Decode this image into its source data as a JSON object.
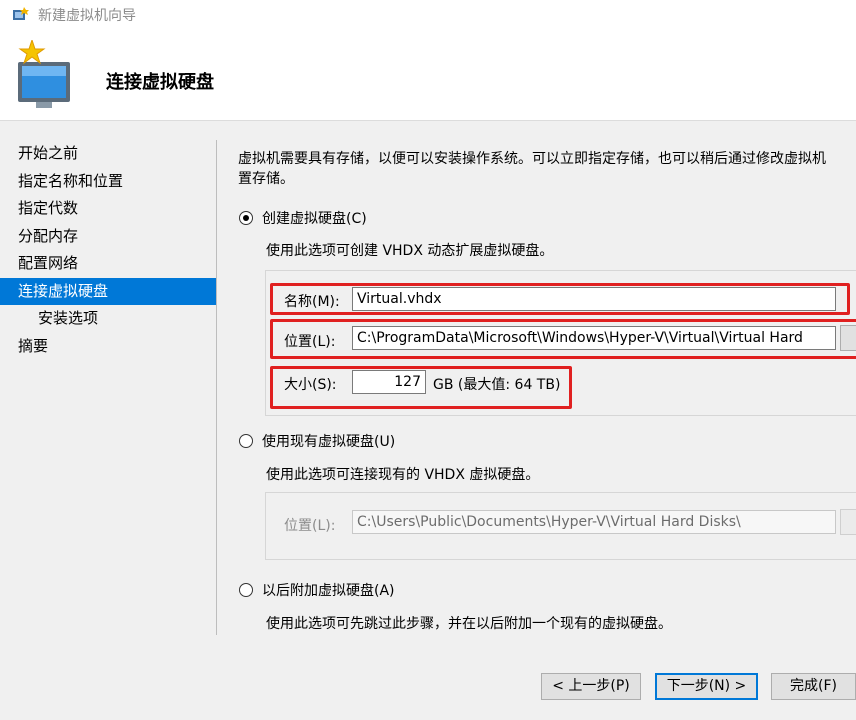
{
  "window": {
    "title": "新建虚拟机向导",
    "icon": "hyperv-icon"
  },
  "header": {
    "title": "连接虚拟硬盘",
    "icon": "wizard-monitor-star-icon"
  },
  "nav": {
    "items": [
      {
        "label": "开始之前"
      },
      {
        "label": "指定名称和位置"
      },
      {
        "label": "指定代数"
      },
      {
        "label": "分配内存"
      },
      {
        "label": "配置网络"
      },
      {
        "label": "连接虚拟硬盘",
        "active": true
      },
      {
        "label": "安装选项",
        "sub": true
      },
      {
        "label": "摘要"
      }
    ]
  },
  "main": {
    "description_line1": "虚拟机需要具有存储，以便可以安装操作系统。可以立即指定存储，也可以稍后通过修改虚拟机",
    "description_line2": "置存储。",
    "option_create": {
      "label": "创建虚拟硬盘(C)",
      "selected": true,
      "hint": "使用此选项可创建 VHDX 动态扩展虚拟硬盘。",
      "name_label": "名称(M):",
      "name_value": "Virtual.vhdx",
      "location_label": "位置(L):",
      "location_value": "C:\\ProgramData\\Microsoft\\Windows\\Hyper-V\\Virtual\\Virtual Hard",
      "size_label": "大小(S):",
      "size_value": "127",
      "size_unit": "GB (最大值: 64 TB)"
    },
    "option_existing": {
      "label": "使用现有虚拟硬盘(U)",
      "selected": false,
      "hint": "使用此选项可连接现有的 VHDX 虚拟硬盘。",
      "location_label": "位置(L):",
      "location_value": "C:\\Users\\Public\\Documents\\Hyper-V\\Virtual Hard Disks\\"
    },
    "option_later": {
      "label": "以后附加虚拟硬盘(A)",
      "selected": false,
      "hint": "使用此选项可先跳过此步骤，并在以后附加一个现有的虚拟硬盘。"
    }
  },
  "buttons": {
    "prev": "< 上一步(P)",
    "next": "下一步(N) >",
    "finish": "完成(F)"
  },
  "colors": {
    "accent": "#0078d7",
    "highlight": "#e02020"
  }
}
